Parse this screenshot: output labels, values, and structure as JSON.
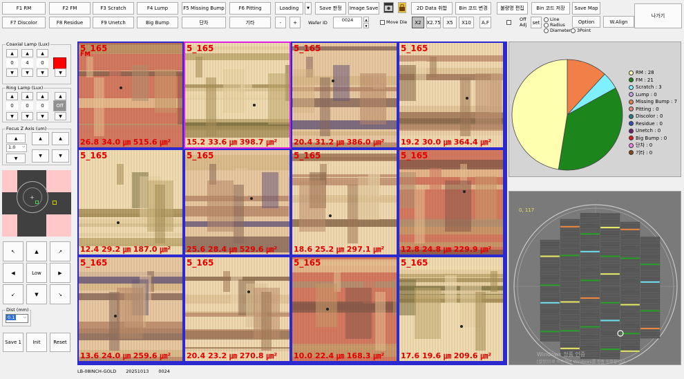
{
  "toolbar": {
    "row1": [
      "F1  RM",
      "F2  FM",
      "F3  Scratch",
      "F4  Lump",
      "F5  Missing Bump",
      "F6  Pitting"
    ],
    "row2": [
      "F7  Discolor",
      "F8  Residue",
      "F9  Unetch",
      "Big Bump",
      "단차",
      "기타"
    ],
    "loading": "Loading",
    "dropdown_arrow": "▼",
    "save_judge": "Save 판정",
    "image_save": "Image Save",
    "data_2d": "2D Data 취합",
    "bin_code_change": "Bin 코드 변경",
    "defect_edit": "불량명 편집",
    "bin_code_save": "Bin 코드 저장",
    "save_map": "Save Map",
    "exit": "나가기",
    "minus": "-",
    "plus": "+",
    "wafer_id_label": "Wafer ID",
    "wafer_id_value": "0024",
    "move_die": "Move Die",
    "zoom": [
      "X2",
      "X2.75",
      "X5",
      "X10"
    ],
    "af": "A.F",
    "offset_adj": "Off Adj",
    "set": "set",
    "radio_options": [
      "Line",
      "Radius",
      "Diameter",
      "3Point"
    ],
    "option": "Option",
    "walign": "W.Align"
  },
  "left": {
    "coaxial_title": "Coaxial Lamp (Lux)",
    "coaxial_values": [
      "0",
      "4",
      "0"
    ],
    "coaxial_state": "On",
    "ring_title": "Ring Lamp (Lux)",
    "ring_values": [
      "0",
      "0",
      "0"
    ],
    "ring_state": "Off",
    "focus_title": "Focus Z Axis (um)",
    "focus_value": "1.0",
    "speed_label": "Low",
    "dist_title": "Dist (mm)",
    "dist_value": "0.1",
    "buttons": [
      "Save 1",
      "Init",
      "Reset"
    ]
  },
  "tiles": [
    {
      "caption": "5_165",
      "defect": "FM",
      "meas": "26.8 34.0 ㎛ 515.6 ㎛²",
      "selected": false
    },
    {
      "caption": "5_165",
      "defect": "",
      "meas": "15.2 33.6 ㎛ 398.7 ㎛²",
      "selected": true
    },
    {
      "caption": "5_165",
      "defect": "",
      "meas": "20.4 31.2 ㎛ 386.0 ㎛²",
      "selected": false
    },
    {
      "caption": "5_165",
      "defect": "",
      "meas": "19.2 30.0 ㎛ 364.4 ㎛²",
      "selected": false
    },
    {
      "caption": "5_165",
      "defect": "",
      "meas": "12.4 29.2 ㎛ 187.0 ㎛²",
      "selected": false
    },
    {
      "caption": "5_165",
      "defect": "",
      "meas": "25.6 28.4 ㎛ 529.6 ㎛²",
      "selected": false
    },
    {
      "caption": "5_165",
      "defect": "",
      "meas": "18.6 25.2 ㎛ 297.1 ㎛²",
      "selected": false
    },
    {
      "caption": "5_165",
      "defect": "",
      "meas": "12.8 24.8 ㎛ 229.9 ㎛²",
      "selected": false
    },
    {
      "caption": "5_165",
      "defect": "",
      "meas": "13.6 24.0 ㎛ 259.6 ㎛²",
      "selected": false
    },
    {
      "caption": "5_165",
      "defect": "",
      "meas": "20.4 23.2 ㎛ 270.8 ㎛²",
      "selected": false
    },
    {
      "caption": "5_165",
      "defect": "",
      "meas": "10.0 22.4 ㎛ 168.3 ㎛²",
      "selected": false
    },
    {
      "caption": "5_165",
      "defect": "",
      "meas": "17.6 19.6 ㎛ 209.6 ㎛²",
      "selected": false
    }
  ],
  "chart_data": {
    "type": "pie",
    "slices": [
      {
        "label": "RM",
        "value": 28,
        "color": "#ffffb0"
      },
      {
        "label": "FM",
        "value": 21,
        "color": "#1c861c"
      },
      {
        "label": "Scratch",
        "value": 3,
        "color": "#7ff0ff"
      },
      {
        "label": "Lump",
        "value": 0,
        "color": "#c8a0e8"
      },
      {
        "label": "Missing Bump",
        "value": 7,
        "color": "#f08048"
      },
      {
        "label": "Pitting",
        "value": 0,
        "color": "#e88878"
      },
      {
        "label": "Discolor",
        "value": 0,
        "color": "#2a7a8a"
      },
      {
        "label": "Residue",
        "value": 0,
        "color": "#3050c0"
      },
      {
        "label": "Unetch",
        "value": 0,
        "color": "#702070"
      },
      {
        "label": "Big Bump",
        "value": 0,
        "color": "#e01818"
      },
      {
        "label": "단차",
        "value": 0,
        "color": "#f080f0"
      },
      {
        "label": "기타",
        "value": 0,
        "color": "#8a4a18"
      }
    ],
    "legend_placement": "right"
  },
  "legend_text": [
    "RM : 28",
    "FM : 21",
    "Scratch : 3",
    "Lump : 0",
    "Missing Bump : 7",
    "Pitting : 0",
    "Discolor : 0",
    "Residue : 0",
    "Unetch : 0",
    "Big Bump : 0",
    "단차 : 0",
    "기타 : 0"
  ],
  "wafer": {
    "corner_label": "0, 117",
    "watermark_line1": "Windows 정품 인증",
    "watermark_line2": "[설정]으로 이동하여 Windows를 정품 인증합니다."
  },
  "status": {
    "recipe": "LB-08INCH-GOLD",
    "date": "20251013",
    "wafer": "0024"
  },
  "colors": {
    "tile_border": "#2a2ad0",
    "selected_border": "#e020e0",
    "measure_text": "#e00000",
    "on_button": "#ff0000"
  }
}
